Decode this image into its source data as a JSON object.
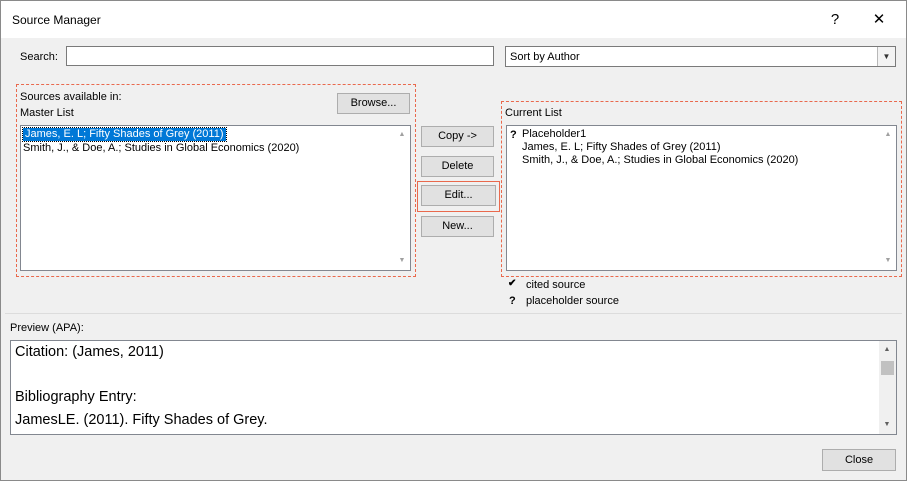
{
  "window": {
    "title": "Source Manager",
    "help_glyph": "?",
    "close_glyph": "✕"
  },
  "search": {
    "label": "Search:",
    "value": "",
    "placeholder": ""
  },
  "sort": {
    "selected": "Sort by Author",
    "arrow": "▼"
  },
  "master": {
    "sources_label": "Sources available in:",
    "list_label": "Master List",
    "browse_label": "Browse...",
    "items": [
      "James, E. L; Fifty Shades of Grey (2011)",
      "Smith, J., & Doe, A.; Studies in Global Economics (2020)"
    ]
  },
  "actions": {
    "copy_label": "Copy ->",
    "delete_label": "Delete",
    "edit_label": "Edit...",
    "new_label": "New..."
  },
  "current": {
    "label": "Current List",
    "items": [
      {
        "marker": "?",
        "text": "Placeholder1"
      },
      {
        "marker": "",
        "text": "James, E. L; Fifty Shades of Grey (2011)"
      },
      {
        "marker": "",
        "text": "Smith, J., & Doe, A.; Studies in Global Economics (2020)"
      }
    ]
  },
  "legend": {
    "cited_symbol": "✔",
    "cited_label": "cited source",
    "placeholder_symbol": "?",
    "placeholder_label": "placeholder source"
  },
  "preview": {
    "label": "Preview (APA):",
    "citation": "Citation:  (James, 2011)",
    "bib_heading": "Bibliography Entry:",
    "bib_entry": "JamesLE. (2011). Fifty Shades of Grey."
  },
  "footer": {
    "close_label": "Close"
  },
  "scroll": {
    "up": "▲",
    "down": "▼"
  }
}
